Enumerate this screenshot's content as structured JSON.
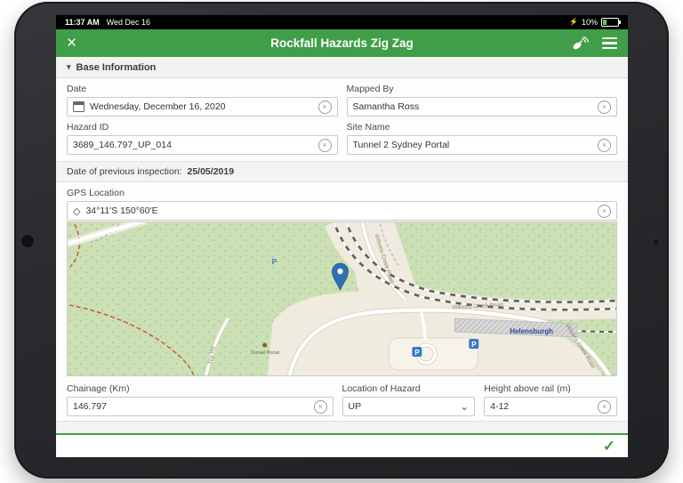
{
  "colors": {
    "accent_green": "#3f9e47",
    "pin_blue": "#2e6fb5",
    "status_bar_black": "#000000"
  },
  "icons": {
    "close": "×",
    "clear": "×",
    "check": "✓",
    "bolt": "⚡",
    "collapse_arrow": "▾",
    "chevron_down": "⌄",
    "diamond": "◇"
  },
  "status_bar": {
    "time": "11:37 AM",
    "date": "Wed Dec 16",
    "battery_percent": "10%"
  },
  "navbar": {
    "title": "Rockfall Hazards Zig Zag"
  },
  "section": {
    "title": "Base Information"
  },
  "form": {
    "date": {
      "label": "Date",
      "value": "Wednesday, December 16, 2020"
    },
    "mapped_by": {
      "label": "Mapped By",
      "value": "Samantha Ross"
    },
    "hazard_id": {
      "label": "Hazard ID",
      "value": "3689_146.797_UP_014"
    },
    "site_name": {
      "label": "Site Name",
      "value": "Tunnel 2 Sydney Portal"
    },
    "previous_inspection": {
      "label": "Date of previous inspection:",
      "value": "25/05/2019"
    },
    "gps": {
      "label": "GPS Location",
      "value": "34°11'S 150°60'E"
    },
    "chainage": {
      "label": "Chainage (Km)",
      "value": "146.797"
    },
    "hazard_location": {
      "label": "Location of Hazard",
      "value": "UP"
    },
    "height_above_rail": {
      "label": "Height above rail (m)",
      "value": "4-12"
    }
  },
  "map": {
    "labels": {
      "road_top": "Wilsons Creek Road",
      "road_mid": "Wilsons Creek Road",
      "road_bottom": "Wilsons Creek Road",
      "town": "Helensburgh",
      "road_left": "The Rd",
      "poi": "Tunnel Portal",
      "parking": "P"
    }
  }
}
